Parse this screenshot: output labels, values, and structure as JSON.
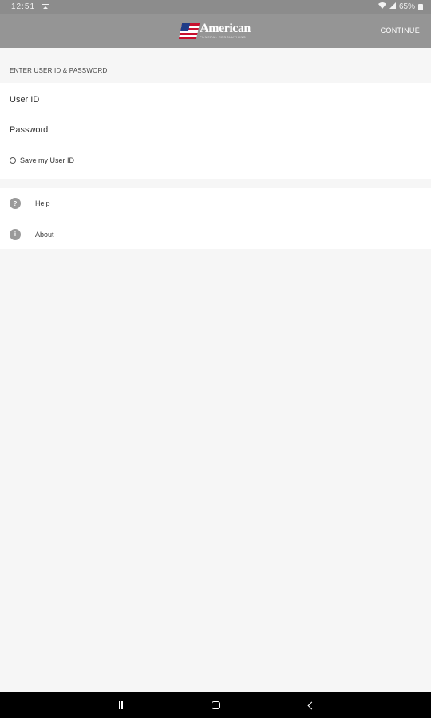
{
  "status_bar": {
    "time": "12:51",
    "battery": "65%",
    "icons": [
      "image-icon",
      "wifi-icon",
      "signal-icon",
      "battery-icon"
    ]
  },
  "app_bar": {
    "brand": "American",
    "brand_sub": "FUNERAL RESOLUTIONS",
    "continue_label": "CONTINUE"
  },
  "login": {
    "section_title": "ENTER USER ID & PASSWORD",
    "user_id_placeholder": "User ID",
    "password_placeholder": "Password",
    "save_label": "Save my User ID"
  },
  "menu": {
    "items": [
      {
        "label": "Help",
        "icon": "help-icon",
        "glyph": "?"
      },
      {
        "label": "About",
        "icon": "info-icon",
        "glyph": "i"
      }
    ]
  },
  "nav": {
    "buttons": [
      "recent-apps-icon",
      "home-icon",
      "back-icon"
    ]
  },
  "colors": {
    "app_bar": "#959595",
    "status_bar": "#8c8c8c",
    "background": "#f6f6f6",
    "flag_red": "#c8102e",
    "flag_blue": "#1f3c88"
  }
}
